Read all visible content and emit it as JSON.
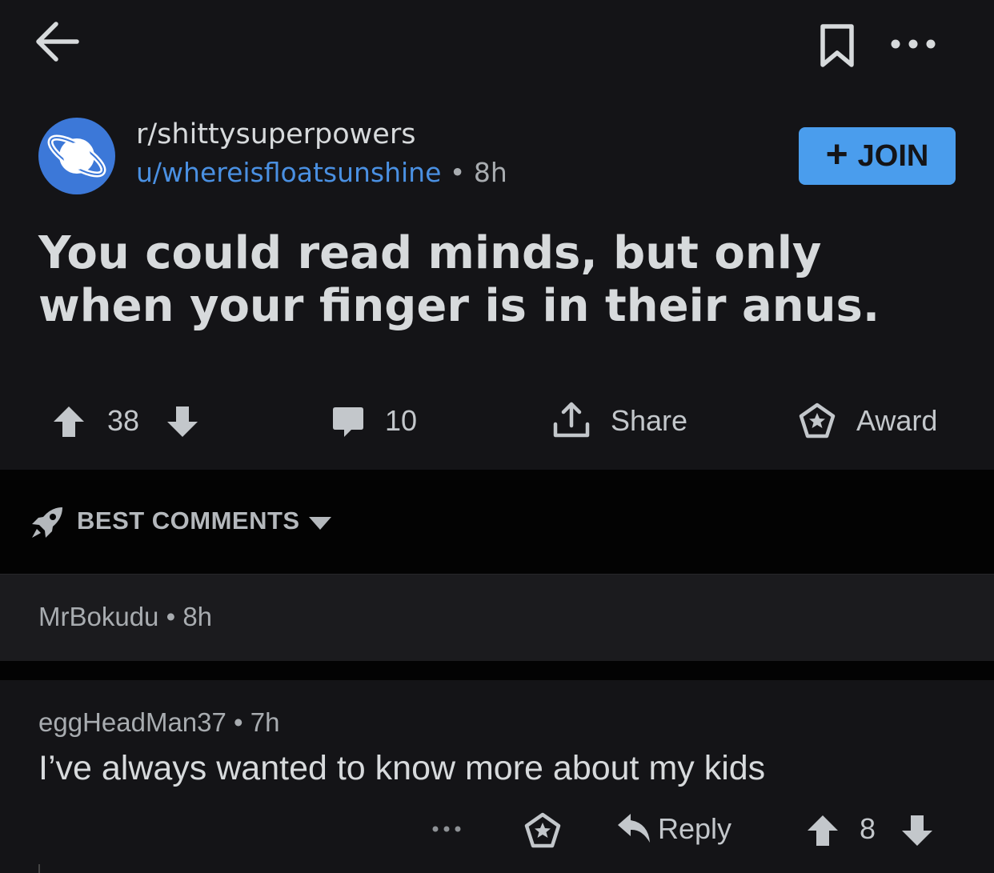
{
  "post": {
    "subreddit": "r/shittysuperpowers",
    "author": "u/whereisfloatsunshine",
    "separator": "•",
    "age": "8h",
    "join_label": "JOIN",
    "join_plus": "+",
    "title": "You could read minds, but only when your finger is in their anus.",
    "score": "38",
    "comment_count": "10",
    "share_label": "Share",
    "award_label": "Award"
  },
  "sort": {
    "label": "BEST COMMENTS"
  },
  "comments": [
    {
      "author": "MrBokudu",
      "separator": "•",
      "age": "8h"
    },
    {
      "author": "eggHeadMan37",
      "separator": "•",
      "age": "7h",
      "body": "I’ve always wanted to know more about my kids",
      "more": "•••",
      "reply_label": "Reply",
      "score": "8"
    }
  ],
  "colors": {
    "background": "#141417",
    "accent": "#4a9ded",
    "author_link": "#4a90e2",
    "avatar": "#3c78d8"
  },
  "icons": {
    "back": "back-arrow-icon",
    "bookmark": "bookmark-icon",
    "more": "more-dots-icon",
    "avatar": "planet-icon",
    "upvote": "upvote-arrow-icon",
    "downvote": "downvote-arrow-icon",
    "comment": "comment-bubble-icon",
    "share": "share-icon",
    "award": "award-icon",
    "sort": "rocket-icon",
    "reply": "reply-arrow-icon"
  }
}
